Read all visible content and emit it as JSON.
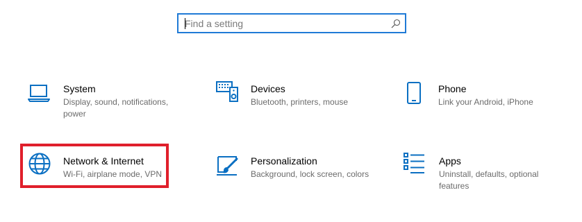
{
  "search": {
    "placeholder": "Find a setting",
    "value": ""
  },
  "accent_color": "#0a6fc2",
  "highlight_color": "#e01f2b",
  "tiles": [
    {
      "title": "System",
      "description": "Display, sound, notifications, power",
      "icon": "laptop-icon"
    },
    {
      "title": "Devices",
      "description": "Bluetooth, printers, mouse",
      "icon": "keyboard-speaker-icon"
    },
    {
      "title": "Phone",
      "description": "Link your Android, iPhone",
      "icon": "phone-icon"
    },
    {
      "title": "Network & Internet",
      "description": "Wi-Fi, airplane mode, VPN",
      "icon": "globe-icon"
    },
    {
      "title": "Personalization",
      "description": "Background, lock screen, colors",
      "icon": "paint-brush-icon"
    },
    {
      "title": "Apps",
      "description": "Uninstall, defaults, optional features",
      "icon": "apps-list-icon"
    }
  ]
}
